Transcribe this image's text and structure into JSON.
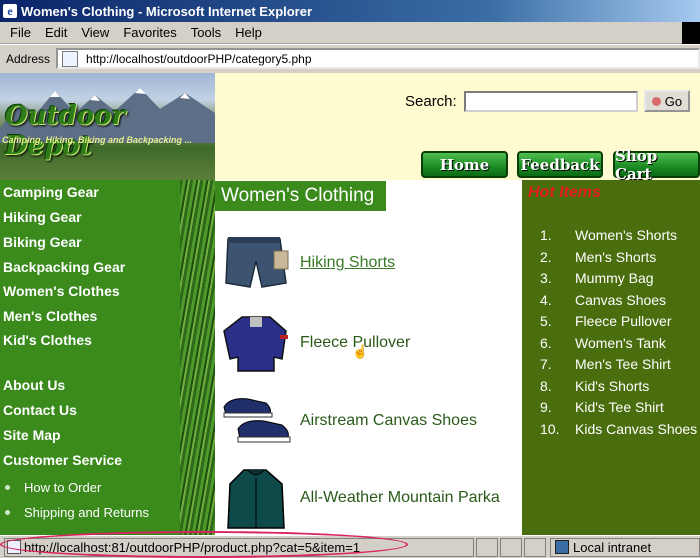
{
  "window": {
    "title": "Women's Clothing - Microsoft Internet Explorer"
  },
  "menu": [
    "File",
    "Edit",
    "View",
    "Favorites",
    "Tools",
    "Help"
  ],
  "address": {
    "label": "Address",
    "url": "http://localhost/outdoorPHP/category5.php"
  },
  "logo": {
    "brand": "Outdoor Depot",
    "tagline": "Camping, Hiking, Biking and Backpacking ..."
  },
  "search": {
    "label": "Search:",
    "value": "",
    "button": "Go"
  },
  "nav_buttons": [
    "Home",
    "Feedback",
    "Shop Cart"
  ],
  "left_nav": {
    "categories": [
      "Camping Gear",
      "Hiking Gear",
      "Biking Gear",
      "Backpacking Gear",
      "Women's Clothes",
      "Men's Clothes",
      "Kid's Clothes"
    ],
    "info": [
      "About Us",
      "Contact Us",
      "Site Map",
      "Customer Service"
    ],
    "sub": [
      "How to Order",
      "Shipping and Returns"
    ]
  },
  "main": {
    "title": "Women's Clothing",
    "products": [
      {
        "name": "Hiking Shorts",
        "icon": "shorts-image"
      },
      {
        "name": "Fleece Pullover",
        "icon": "pullover-image"
      },
      {
        "name": "Airstream Canvas Shoes",
        "icon": "shoes-image"
      },
      {
        "name": "All-Weather Mountain Parka",
        "icon": "parka-image"
      }
    ]
  },
  "hot_items": {
    "title": "Hot Items",
    "items": [
      {
        "num": "1.",
        "label": "Women's Shorts"
      },
      {
        "num": "2.",
        "label": "Men's Shorts"
      },
      {
        "num": "3.",
        "label": "Mummy Bag"
      },
      {
        "num": "4.",
        "label": "Canvas Shoes"
      },
      {
        "num": "5.",
        "label": "Fleece Pullover"
      },
      {
        "num": "6.",
        "label": "Women's Tank"
      },
      {
        "num": "7.",
        "label": "Men's Tee Shirt"
      },
      {
        "num": "8.",
        "label": "Kid's Shorts"
      },
      {
        "num": "9.",
        "label": "Kid's Tee Shirt"
      },
      {
        "num": "10.",
        "label": "Kids Canvas Shoes"
      }
    ]
  },
  "status": {
    "url": "http://localhost:81/outdoorPHP/product.php?cat=5&item=1",
    "zone": "Local intranet"
  },
  "colors": {
    "nav_green": "#3a8a1c",
    "hot_bg": "#4a6d0e",
    "hot_title": "#e21b1b",
    "header_bg": "#fefbd0",
    "highlight_oval": "#d8245f"
  }
}
